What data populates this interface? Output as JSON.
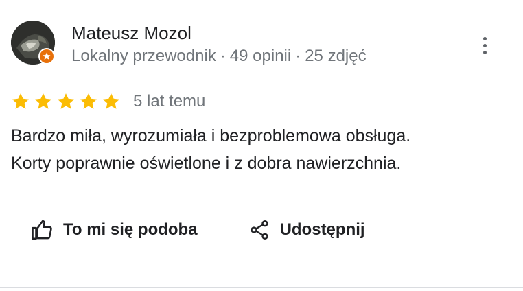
{
  "review": {
    "author": {
      "name": "Mateusz Mozol",
      "role": "Lokalny przewodnik",
      "reviews_count": "49 opinii",
      "photos_count": "25 zdjęć",
      "separator": "·",
      "avatar_icon": "user-photo",
      "badge_icon": "local-guide-star-icon",
      "badge_color": "#e8710a"
    },
    "more_icon": "more-vert-icon",
    "rating": {
      "value": 5,
      "max": 5,
      "star_color": "#fbbc04"
    },
    "date": "5 lat temu",
    "text_lines": [
      "Bardzo miła, wyrozumiała i bezproblemowa obsługa.",
      "Korty poprawnie oświetlone i z dobra nawierzchnia."
    ],
    "actions": {
      "like_label": "To mi się podoba",
      "like_icon": "thumb-up-icon",
      "share_label": "Udostępnij",
      "share_icon": "share-icon"
    }
  }
}
